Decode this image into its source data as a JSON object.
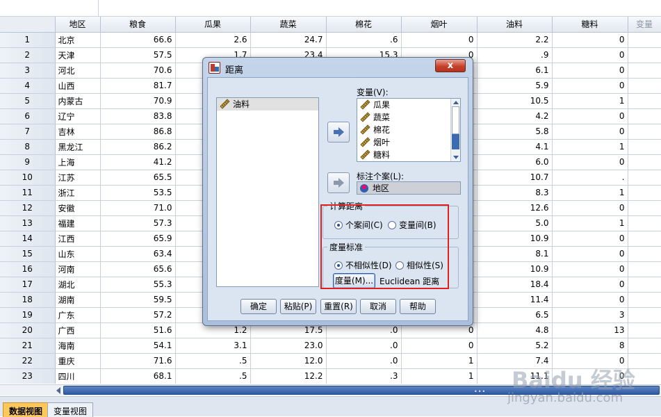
{
  "grid": {
    "columns": [
      "地区",
      "粮食",
      "瓜果",
      "蔬菜",
      "棉花",
      "烟叶",
      "油料",
      "糖料",
      "变量"
    ],
    "rows": [
      {
        "n": "1",
        "cells": [
          "北京",
          "66.6",
          "2.6",
          "24.7",
          ".6",
          "0",
          "2.2",
          "0"
        ]
      },
      {
        "n": "2",
        "cells": [
          "天津",
          "57.5",
          "1.7",
          "23.4",
          "15.3",
          "0",
          ".9",
          "0"
        ]
      },
      {
        "n": "3",
        "cells": [
          "河北",
          "70.6",
          "",
          "",
          "",
          "0",
          "6.1",
          "0"
        ]
      },
      {
        "n": "4",
        "cells": [
          "山西",
          "81.7",
          "",
          "",
          "",
          "0",
          "5.9",
          "0"
        ]
      },
      {
        "n": "5",
        "cells": [
          "内蒙古",
          "70.9",
          "",
          "",
          "",
          "0",
          "10.5",
          "1"
        ]
      },
      {
        "n": "6",
        "cells": [
          "辽宁",
          "83.8",
          "",
          "",
          "",
          "0",
          "4.2",
          "0"
        ]
      },
      {
        "n": "7",
        "cells": [
          "吉林",
          "86.8",
          "",
          "",
          "",
          "1",
          "5.8",
          "0"
        ]
      },
      {
        "n": "8",
        "cells": [
          "黑龙江",
          "86.2",
          "",
          "",
          "",
          "0",
          "4.1",
          "1"
        ]
      },
      {
        "n": "9",
        "cells": [
          "上海",
          "41.2",
          "",
          "",
          "",
          "0",
          "6.0",
          "0"
        ]
      },
      {
        "n": "10",
        "cells": [
          "江苏",
          "65.5",
          "",
          "",
          "",
          "0",
          "10.7",
          "."
        ]
      },
      {
        "n": "11",
        "cells": [
          "浙江",
          "53.5",
          "",
          "",
          "",
          "0",
          "8.3",
          "1"
        ]
      },
      {
        "n": "12",
        "cells": [
          "安徽",
          "71.0",
          "",
          "",
          "",
          "0",
          "12.6",
          "0"
        ]
      },
      {
        "n": "13",
        "cells": [
          "福建",
          "57.3",
          "",
          "",
          "",
          "3",
          "5.0",
          "1"
        ]
      },
      {
        "n": "14",
        "cells": [
          "江西",
          "65.9",
          "",
          "",
          "",
          "0",
          "10.9",
          "0"
        ]
      },
      {
        "n": "15",
        "cells": [
          "山东",
          "63.4",
          "",
          "",
          "",
          "0",
          "8.1",
          "0"
        ]
      },
      {
        "n": "16",
        "cells": [
          "河南",
          "65.6",
          "",
          "",
          "",
          "1",
          "10.9",
          "0"
        ]
      },
      {
        "n": "17",
        "cells": [
          "湖北",
          "55.3",
          "",
          "",
          "",
          "1",
          "18.4",
          "0"
        ]
      },
      {
        "n": "18",
        "cells": [
          "湖南",
          "59.5",
          "",
          "",
          "",
          "1",
          "11.4",
          "0"
        ]
      },
      {
        "n": "19",
        "cells": [
          "广东",
          "57.2",
          "",
          "",
          "",
          "1",
          "6.5",
          "3"
        ]
      },
      {
        "n": "20",
        "cells": [
          "广西",
          "51.6",
          "1.2",
          "17.5",
          ".0",
          "0",
          "4.8",
          "13"
        ]
      },
      {
        "n": "21",
        "cells": [
          "海南",
          "54.1",
          "3.1",
          "23.0",
          ".0",
          "0",
          "5.2",
          "8"
        ]
      },
      {
        "n": "22",
        "cells": [
          "重庆",
          "71.6",
          ".5",
          "12.0",
          ".0",
          "1",
          "7.4",
          "0"
        ]
      },
      {
        "n": "23",
        "cells": [
          "四川",
          "68.1",
          ".5",
          "12.2",
          ".3",
          "1",
          "11.1",
          "0"
        ]
      }
    ]
  },
  "tabs": {
    "data_view": "数据视图",
    "variable_view": "变量视图"
  },
  "dialog": {
    "title": "距离",
    "close": "x",
    "source_list": [
      "油料"
    ],
    "variables_label": "变量(V):",
    "variables": [
      "瓜果",
      "蔬菜",
      "棉花",
      "烟叶",
      "糖料"
    ],
    "label_cases_label": "标注个案(L):",
    "label_cases_value": "地区",
    "compute_distance": {
      "title": "计算距离",
      "option_cases": "个案间(C)",
      "option_variables": "变量间(B)",
      "selected": "cases"
    },
    "measure": {
      "title": "度量标准",
      "option_dissimilarity": "不相似性(D)",
      "option_similarity": "相似性(S)",
      "selected": "dissimilarity",
      "button": "度量(M)...",
      "current": "Euclidean 距离"
    },
    "buttons": {
      "ok": "确定",
      "paste": "粘贴(P)",
      "reset": "重置(R)",
      "cancel": "取消",
      "help": "帮助"
    }
  },
  "watermark": {
    "main": "Baidu 经验",
    "sub": "jingyan.baidu.com"
  },
  "colors": {
    "highlight_box": "#e02020",
    "active_tab": "#ffc85a",
    "scrollbar": "#2e5aa3"
  }
}
